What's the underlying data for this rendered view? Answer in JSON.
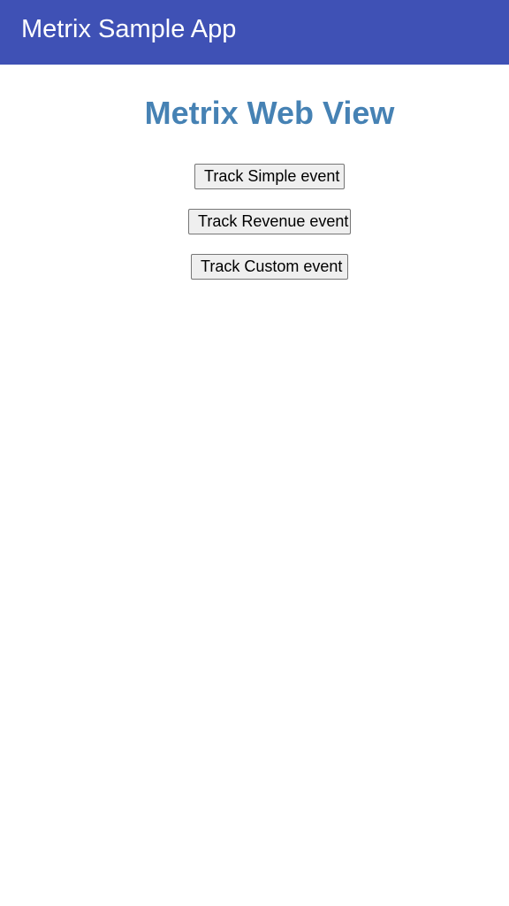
{
  "app_bar": {
    "title": "Metrix Sample App",
    "background_color": "#3f51b5"
  },
  "webview": {
    "heading": "Metrix Web View",
    "heading_color": "#4682b4",
    "buttons": [
      {
        "label": "Track Simple event"
      },
      {
        "label": "Track Revenue event"
      },
      {
        "label": "Track Custom event"
      }
    ]
  }
}
